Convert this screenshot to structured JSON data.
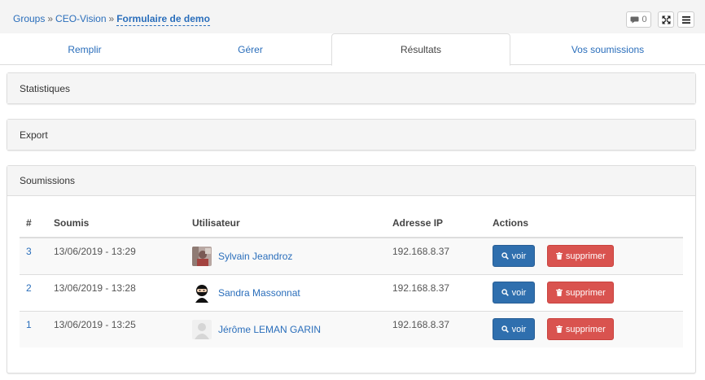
{
  "breadcrumb": {
    "items": [
      "Groups",
      "CEO-Vision"
    ],
    "separator": "»",
    "current": "Formulaire de demo"
  },
  "toolbar": {
    "comments_count": "0",
    "comments_icon": "comment-icon",
    "expand_icon": "fullscreen-icon",
    "menu_icon": "hamburger-icon"
  },
  "tabs": [
    {
      "label": "Remplir",
      "active": false
    },
    {
      "label": "Gérer",
      "active": false
    },
    {
      "label": "Résultats",
      "active": true
    },
    {
      "label": "Vos soumissions",
      "active": false
    }
  ],
  "panels": {
    "statistics": "Statistiques",
    "export": "Export",
    "submissions": "Soumissions"
  },
  "table": {
    "headers": [
      "#",
      "Soumis",
      "Utilisateur",
      "Adresse IP",
      "Actions"
    ],
    "rows": [
      {
        "id": "3",
        "date": "13/06/2019 - 13:29",
        "user": "Sylvain Jeandroz",
        "avatar": "photo",
        "ip": "192.168.8.37"
      },
      {
        "id": "2",
        "date": "13/06/2019 - 13:28",
        "user": "Sandra Massonnat",
        "avatar": "ninja",
        "ip": "192.168.8.37"
      },
      {
        "id": "1",
        "date": "13/06/2019 - 13:25",
        "user": "Jérôme LEMAN GARIN",
        "avatar": "default",
        "ip": "192.168.8.37"
      }
    ],
    "view_label": "voir",
    "delete_label": "supprimer"
  },
  "colors": {
    "link": "#2a6ebb",
    "view_button": "#2f6fae",
    "delete_button": "#d9534f"
  }
}
